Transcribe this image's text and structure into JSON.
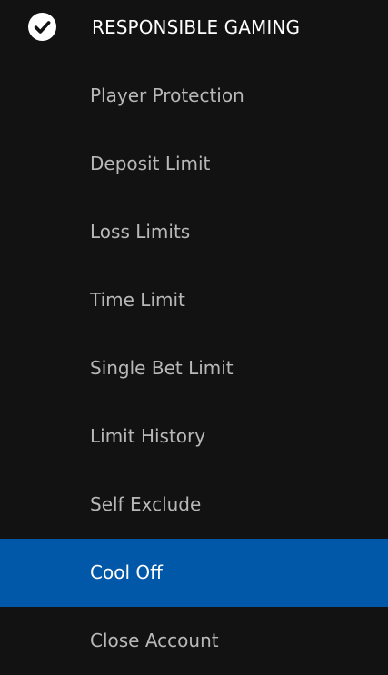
{
  "header": {
    "icon": "check-circle-icon",
    "title": "RESPONSIBLE GAMING"
  },
  "menu": {
    "active_index": 7,
    "items": [
      {
        "label": "Player Protection"
      },
      {
        "label": "Deposit Limit"
      },
      {
        "label": "Loss Limits"
      },
      {
        "label": "Time Limit"
      },
      {
        "label": "Single Bet Limit"
      },
      {
        "label": "Limit History"
      },
      {
        "label": "Self Exclude"
      },
      {
        "label": "Cool Off"
      },
      {
        "label": "Close Account"
      }
    ]
  },
  "colors": {
    "background": "#121212",
    "active_background": "#0158a8",
    "text": "#b8b8b8",
    "active_text": "#ffffff"
  }
}
